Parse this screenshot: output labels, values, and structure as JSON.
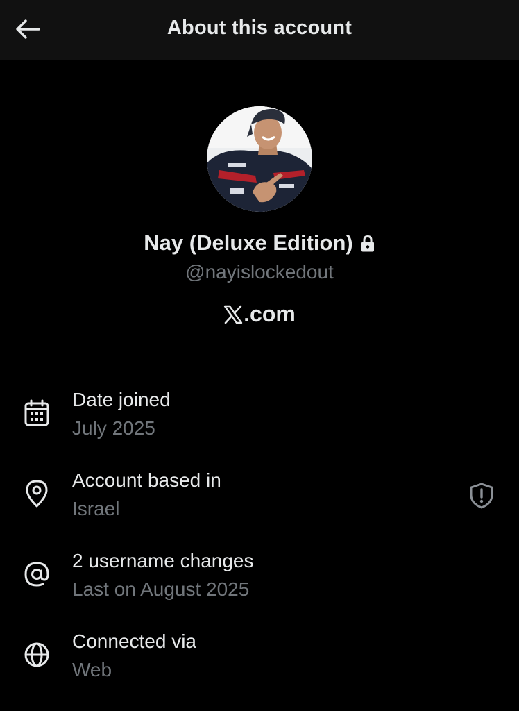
{
  "header": {
    "title": "About this account",
    "back_icon": "arrow-left-icon"
  },
  "profile": {
    "display_name": "Nay (Deluxe Edition)",
    "protected_icon": "lock-icon",
    "handle": "@nayislockedout",
    "site_logo_icon": "x-logo-icon",
    "site_suffix": ".com"
  },
  "details": [
    {
      "icon": "calendar-icon",
      "title": "Date joined",
      "value": "July 2025"
    },
    {
      "icon": "location-pin-icon",
      "title": "Account based in",
      "value": "Israel",
      "action_icon": "shield-alert-icon"
    },
    {
      "icon": "at-sign-icon",
      "title": "2 username changes",
      "value": "Last on August 2025"
    },
    {
      "icon": "globe-icon",
      "title": "Connected via",
      "value": "Web"
    }
  ],
  "colors": {
    "background": "#000000",
    "header_background": "#111111",
    "primary_text": "#e7e9ea",
    "secondary_text": "#71767b"
  }
}
